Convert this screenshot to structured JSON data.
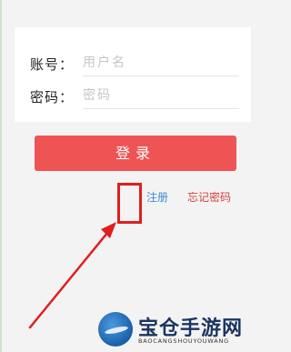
{
  "form": {
    "username": {
      "label": "账号：",
      "value": "",
      "placeholder": "用户名"
    },
    "password": {
      "label": "密码：",
      "value": "",
      "placeholder": "密码"
    }
  },
  "actions": {
    "login_label": "登录",
    "register_label": "注册",
    "forgot_label": "忘记密码"
  },
  "watermark": {
    "title": "宝仓手游网",
    "subtitle": "BAOCANGSHOUYOUWANG"
  },
  "colors": {
    "page_background": "#f3f3f3",
    "login_button": "#ef5454",
    "register_link": "#3d8bd6",
    "forgot_link": "#d6433d",
    "annotation": "#e01e1e",
    "watermark_text": "#1a3560"
  }
}
